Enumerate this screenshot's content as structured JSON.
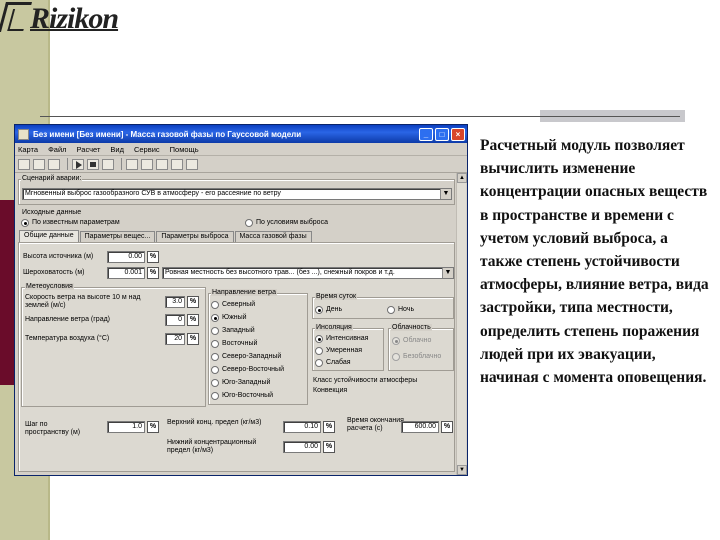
{
  "slide": {
    "logo_text": "Rizikon",
    "description": "Расчетный модуль позволяет вычислить изменение концентрации опасных веществ в пространстве и времени с учетом условий выброса, а также степень устойчивости атмосферы, влияние ветра, вида застройки, типа местности, определить степень поражения людей при их эвакуации, начиная с момента оповещения."
  },
  "window": {
    "title": "Без имени [Без имени] - Масса газовой фазы по Гауссовой модели",
    "buttons": {
      "minimize": "_",
      "maximize": "□",
      "close": "×"
    },
    "menu": [
      "Карта",
      "Файл",
      "Расчет",
      "Вид",
      "Сервис",
      "Помощь"
    ]
  },
  "scenario": {
    "label": "Сценарий аварии:",
    "value": "Мгновенный выброс газообразного СУВ в атмосферу - его рассеяние по ветру"
  },
  "source_data": {
    "label": "Исходные данные",
    "option_known": "По известным параметрам",
    "option_conditions": "По условиям выброса"
  },
  "tabs": [
    "Общие данные",
    "Параметры вещес...",
    "Параметры выброса",
    "Масса газовой фазы"
  ],
  "general": {
    "height_label": "Высота источника (м)",
    "height_value": "0.00",
    "roughness_label": "Шероховатость (м)",
    "roughness_value": "0.001",
    "roughness_desc": "Ровная местность без высотного трав... (без ...), снежный покров и т.д."
  },
  "meteo": {
    "label": "Метеоусловия",
    "wind_speed_label": "Скорость ветра на высоте 10 м над землей (м/с)",
    "wind_speed_value": "3.0",
    "wind_dir_label": "Направление ветра (град)",
    "wind_dir_value": "0",
    "air_temp_label": "Температура воздуха (°С)",
    "air_temp_value": "20"
  },
  "wind_direction": {
    "label": "Направление ветра",
    "options": [
      "Северный",
      "Южный",
      "Западный",
      "Восточный",
      "Северо-Западный",
      "Северо-Восточный",
      "Юго-Западный",
      "Юго-Восточный"
    ],
    "selected": "Южный"
  },
  "time_of_day": {
    "label": "Время суток",
    "options": [
      "День",
      "Ночь"
    ],
    "selected": "День"
  },
  "insolation": {
    "label": "Инсоляция",
    "options": [
      "Интенсивная",
      "Умеренная",
      "Слабая"
    ],
    "selected": "Интенсивная"
  },
  "cloudiness": {
    "label": "Облачность",
    "options": [
      "Облачно",
      "Безоблачно"
    ],
    "selected": "Облачно"
  },
  "stability": {
    "label": "Класс устойчивости атмосферы",
    "value": "Конвекция"
  },
  "bottom": {
    "step_label": "Шаг по пространству (м)",
    "step_value": "1.0",
    "upper_limit_label": "Верхний конц. предел (кг/м3)",
    "upper_limit_value": "0.10",
    "lower_limit_label": "Нижний концентрационный предел (кг/м3)",
    "lower_limit_value": "0.00",
    "time_label": "Время окончания расчета (с)",
    "time_value": "600.00"
  }
}
